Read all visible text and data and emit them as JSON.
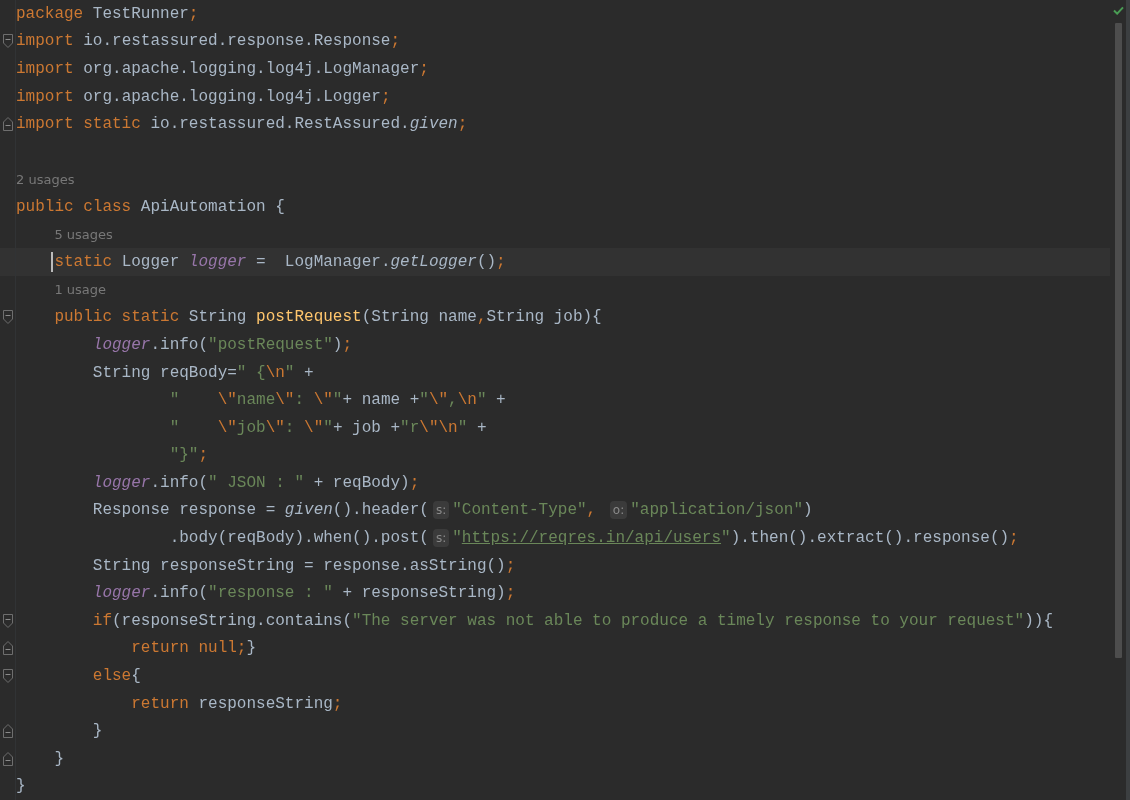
{
  "editor": {
    "lines": [
      {
        "kind": "code",
        "current": false,
        "segments": [
          {
            "kind": "code",
            "tokens": [
              {
                "kind": "kw",
                "text": "package "
              },
              {
                "kind": "plain",
                "text": "TestRunner"
              },
              {
                "kind": "punct",
                "text": ";"
              }
            ]
          }
        ]
      },
      {
        "kind": "code",
        "current": false,
        "fold_start": true,
        "segments": [
          {
            "kind": "code",
            "tokens": [
              {
                "kind": "kw",
                "text": "import "
              },
              {
                "kind": "plain",
                "text": "io.restassured.response.Response"
              },
              {
                "kind": "punct",
                "text": ";"
              }
            ]
          }
        ]
      },
      {
        "kind": "code",
        "current": false,
        "segments": [
          {
            "kind": "code",
            "tokens": [
              {
                "kind": "kw",
                "text": "import "
              },
              {
                "kind": "plain",
                "text": "org.apache.logging.log4j.LogManager"
              },
              {
                "kind": "punct",
                "text": ";"
              }
            ]
          }
        ]
      },
      {
        "kind": "code",
        "current": false,
        "segments": [
          {
            "kind": "code",
            "tokens": [
              {
                "kind": "kw",
                "text": "import "
              },
              {
                "kind": "plain",
                "text": "org.apache.logging.log4j.Logger"
              },
              {
                "kind": "punct",
                "text": ";"
              }
            ]
          }
        ]
      },
      {
        "kind": "code",
        "current": false,
        "fold_end": true,
        "segments": [
          {
            "kind": "code",
            "tokens": [
              {
                "kind": "kw",
                "text": "import static "
              },
              {
                "kind": "plain",
                "text": "io.restassured.RestAssured."
              },
              {
                "kind": "static",
                "text": "given"
              },
              {
                "kind": "punct",
                "text": ";"
              }
            ]
          }
        ]
      },
      {
        "kind": "blank",
        "current": false
      },
      {
        "kind": "usages",
        "current": false,
        "text": "2 usages"
      },
      {
        "kind": "code",
        "current": false,
        "segments": [
          {
            "kind": "code",
            "tokens": [
              {
                "kind": "kw",
                "text": "public class "
              },
              {
                "kind": "plain",
                "text": "ApiAutomation {"
              }
            ]
          }
        ]
      },
      {
        "kind": "usages",
        "current": false,
        "text": "    5 usages"
      },
      {
        "kind": "code",
        "current": true,
        "segments": [
          {
            "kind": "code",
            "tokens": [
              {
                "kind": "kw",
                "text": "    static "
              },
              {
                "kind": "plain",
                "text": "Logger "
              },
              {
                "kind": "field",
                "text": "logger"
              },
              {
                "kind": "plain",
                "text": " =  LogManager."
              },
              {
                "kind": "static",
                "text": "getLogger"
              },
              {
                "kind": "plain",
                "text": "()"
              },
              {
                "kind": "punct",
                "text": ";"
              }
            ]
          }
        ]
      },
      {
        "kind": "usages",
        "current": false,
        "text": "    1 usage"
      },
      {
        "kind": "code",
        "current": false,
        "fold_start": true,
        "segments": [
          {
            "kind": "code",
            "tokens": [
              {
                "kind": "kw",
                "text": "    public static "
              },
              {
                "kind": "plain",
                "text": "String "
              },
              {
                "kind": "decl",
                "text": "postRequest"
              },
              {
                "kind": "plain",
                "text": "(String name"
              },
              {
                "kind": "punct",
                "text": ","
              },
              {
                "kind": "plain",
                "text": "String job){"
              }
            ]
          }
        ]
      },
      {
        "kind": "code",
        "current": false,
        "segments": [
          {
            "kind": "code",
            "tokens": [
              {
                "kind": "field",
                "text": "        logger"
              },
              {
                "kind": "plain",
                "text": ".info("
              },
              {
                "kind": "str",
                "text": "\"postRequest\""
              },
              {
                "kind": "plain",
                "text": ")"
              },
              {
                "kind": "punct",
                "text": ";"
              }
            ]
          }
        ]
      },
      {
        "kind": "code",
        "current": false,
        "segments": [
          {
            "kind": "code",
            "tokens": [
              {
                "kind": "plain",
                "text": "        String reqBody="
              },
              {
                "kind": "str",
                "text": "\" {"
              },
              {
                "kind": "esc",
                "text": "\\n"
              },
              {
                "kind": "str",
                "text": "\""
              },
              {
                "kind": "plain",
                "text": " +"
              }
            ]
          }
        ]
      },
      {
        "kind": "code",
        "current": false,
        "segments": [
          {
            "kind": "code",
            "tokens": [
              {
                "kind": "str",
                "text": "                \"    "
              },
              {
                "kind": "esc",
                "text": "\\\""
              },
              {
                "kind": "str",
                "text": "name"
              },
              {
                "kind": "esc",
                "text": "\\\""
              },
              {
                "kind": "str",
                "text": ": "
              },
              {
                "kind": "esc",
                "text": "\\\""
              },
              {
                "kind": "str",
                "text": "\""
              },
              {
                "kind": "plain",
                "text": "+ name +"
              },
              {
                "kind": "str",
                "text": "\""
              },
              {
                "kind": "esc",
                "text": "\\\""
              },
              {
                "kind": "str",
                "text": ","
              },
              {
                "kind": "esc",
                "text": "\\n"
              },
              {
                "kind": "str",
                "text": "\""
              },
              {
                "kind": "plain",
                "text": " +"
              }
            ]
          }
        ]
      },
      {
        "kind": "code",
        "current": false,
        "segments": [
          {
            "kind": "code",
            "tokens": [
              {
                "kind": "str",
                "text": "                \"    "
              },
              {
                "kind": "esc",
                "text": "\\\""
              },
              {
                "kind": "str",
                "text": "job"
              },
              {
                "kind": "esc",
                "text": "\\\""
              },
              {
                "kind": "str",
                "text": ": "
              },
              {
                "kind": "esc",
                "text": "\\\""
              },
              {
                "kind": "str",
                "text": "\""
              },
              {
                "kind": "plain",
                "text": "+ job +"
              },
              {
                "kind": "str",
                "text": "\"r"
              },
              {
                "kind": "esc",
                "text": "\\\""
              },
              {
                "kind": "esc",
                "text": "\\n"
              },
              {
                "kind": "str",
                "text": "\""
              },
              {
                "kind": "plain",
                "text": " +"
              }
            ]
          }
        ]
      },
      {
        "kind": "code",
        "current": false,
        "segments": [
          {
            "kind": "code",
            "tokens": [
              {
                "kind": "str",
                "text": "                \"}\""
              },
              {
                "kind": "punct",
                "text": ";"
              }
            ]
          }
        ]
      },
      {
        "kind": "code",
        "current": false,
        "segments": [
          {
            "kind": "code",
            "tokens": [
              {
                "kind": "field",
                "text": "        logger"
              },
              {
                "kind": "plain",
                "text": ".info("
              },
              {
                "kind": "str",
                "text": "\" JSON : \""
              },
              {
                "kind": "plain",
                "text": " + reqBody)"
              },
              {
                "kind": "punct",
                "text": ";"
              }
            ]
          }
        ]
      },
      {
        "kind": "code",
        "current": false,
        "segments": [
          {
            "kind": "code",
            "tokens": [
              {
                "kind": "plain",
                "text": "        Response response = "
              },
              {
                "kind": "static",
                "text": "given"
              },
              {
                "kind": "plain",
                "text": "().header("
              }
            ]
          },
          {
            "kind": "hint",
            "text": "s:"
          },
          {
            "kind": "code",
            "tokens": [
              {
                "kind": "str",
                "text": "\"Content-Type\""
              },
              {
                "kind": "punct",
                "text": ", "
              }
            ]
          },
          {
            "kind": "hint",
            "text": "o:"
          },
          {
            "kind": "code",
            "tokens": [
              {
                "kind": "str",
                "text": "\"application/json\""
              },
              {
                "kind": "plain",
                "text": ")"
              }
            ]
          }
        ]
      },
      {
        "kind": "code",
        "current": false,
        "segments": [
          {
            "kind": "code",
            "tokens": [
              {
                "kind": "plain",
                "text": "                .body(reqBody).when().post("
              }
            ]
          },
          {
            "kind": "hint",
            "text": "s:"
          },
          {
            "kind": "code",
            "tokens": [
              {
                "kind": "str",
                "text": "\""
              }
            ]
          },
          {
            "kind": "link",
            "text": "https://reqres.in/api/users"
          },
          {
            "kind": "code",
            "tokens": [
              {
                "kind": "str",
                "text": "\""
              },
              {
                "kind": "plain",
                "text": ").then().extract().response()"
              },
              {
                "kind": "punct",
                "text": ";"
              }
            ]
          }
        ]
      },
      {
        "kind": "code",
        "current": false,
        "segments": [
          {
            "kind": "code",
            "tokens": [
              {
                "kind": "plain",
                "text": "        String responseString = response.asString()"
              },
              {
                "kind": "punct",
                "text": ";"
              }
            ]
          }
        ]
      },
      {
        "kind": "code",
        "current": false,
        "segments": [
          {
            "kind": "code",
            "tokens": [
              {
                "kind": "field",
                "text": "        logger"
              },
              {
                "kind": "plain",
                "text": ".info("
              },
              {
                "kind": "str",
                "text": "\"response : \""
              },
              {
                "kind": "plain",
                "text": " + responseString)"
              },
              {
                "kind": "punct",
                "text": ";"
              }
            ]
          }
        ]
      },
      {
        "kind": "code",
        "current": false,
        "fold_start": true,
        "segments": [
          {
            "kind": "code",
            "tokens": [
              {
                "kind": "kw",
                "text": "        if"
              },
              {
                "kind": "plain",
                "text": "(responseString.contains("
              },
              {
                "kind": "str",
                "text": "\"The server was not able to produce a timely response to your request\""
              },
              {
                "kind": "plain",
                "text": ")){"
              }
            ]
          }
        ]
      },
      {
        "kind": "code",
        "current": false,
        "fold_end": true,
        "segments": [
          {
            "kind": "code",
            "tokens": [
              {
                "kind": "kw",
                "text": "            return null"
              },
              {
                "kind": "punct",
                "text": ";"
              },
              {
                "kind": "plain",
                "text": "}"
              }
            ]
          }
        ]
      },
      {
        "kind": "code",
        "current": false,
        "fold_start": true,
        "segments": [
          {
            "kind": "code",
            "tokens": [
              {
                "kind": "kw",
                "text": "        else"
              },
              {
                "kind": "plain",
                "text": "{"
              }
            ]
          }
        ]
      },
      {
        "kind": "code",
        "current": false,
        "segments": [
          {
            "kind": "code",
            "tokens": [
              {
                "kind": "kw",
                "text": "            return "
              },
              {
                "kind": "plain",
                "text": "responseString"
              },
              {
                "kind": "punct",
                "text": ";"
              }
            ]
          }
        ]
      },
      {
        "kind": "code",
        "current": false,
        "fold_end": true,
        "segments": [
          {
            "kind": "code",
            "tokens": [
              {
                "kind": "plain",
                "text": "        }"
              }
            ]
          }
        ]
      },
      {
        "kind": "code",
        "current": false,
        "fold_end": true,
        "segments": [
          {
            "kind": "code",
            "tokens": [
              {
                "kind": "plain",
                "text": "    }"
              }
            ]
          }
        ]
      },
      {
        "kind": "code",
        "current": false,
        "segments": [
          {
            "kind": "code",
            "tokens": [
              {
                "kind": "plain",
                "text": "}"
              }
            ]
          }
        ]
      }
    ]
  }
}
